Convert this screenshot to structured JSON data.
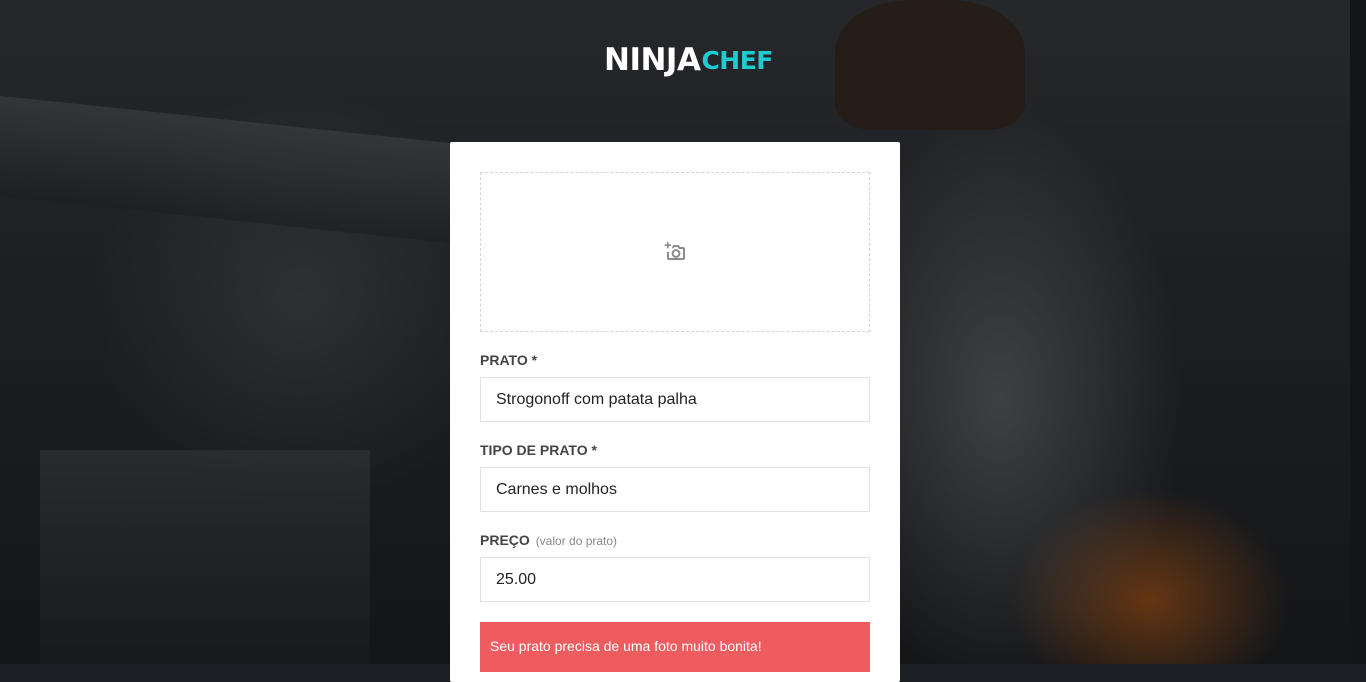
{
  "brand": {
    "part1": "NINJA",
    "part2": "CHEF",
    "accent_color": "#1ecbd0"
  },
  "upload": {
    "icon": "add-photo-icon"
  },
  "form": {
    "dish": {
      "label": "PRATO *",
      "value": "Strogonoff com patata palha"
    },
    "dish_type": {
      "label": "TIPO DE PRATO *",
      "value": "Carnes e molhos"
    },
    "price": {
      "label": "PREÇO",
      "hint": "(valor do prato)",
      "value": "25.00"
    }
  },
  "alert": {
    "message": "Seu prato precisa de uma foto muito bonita!",
    "color": "#ef5c5f"
  }
}
